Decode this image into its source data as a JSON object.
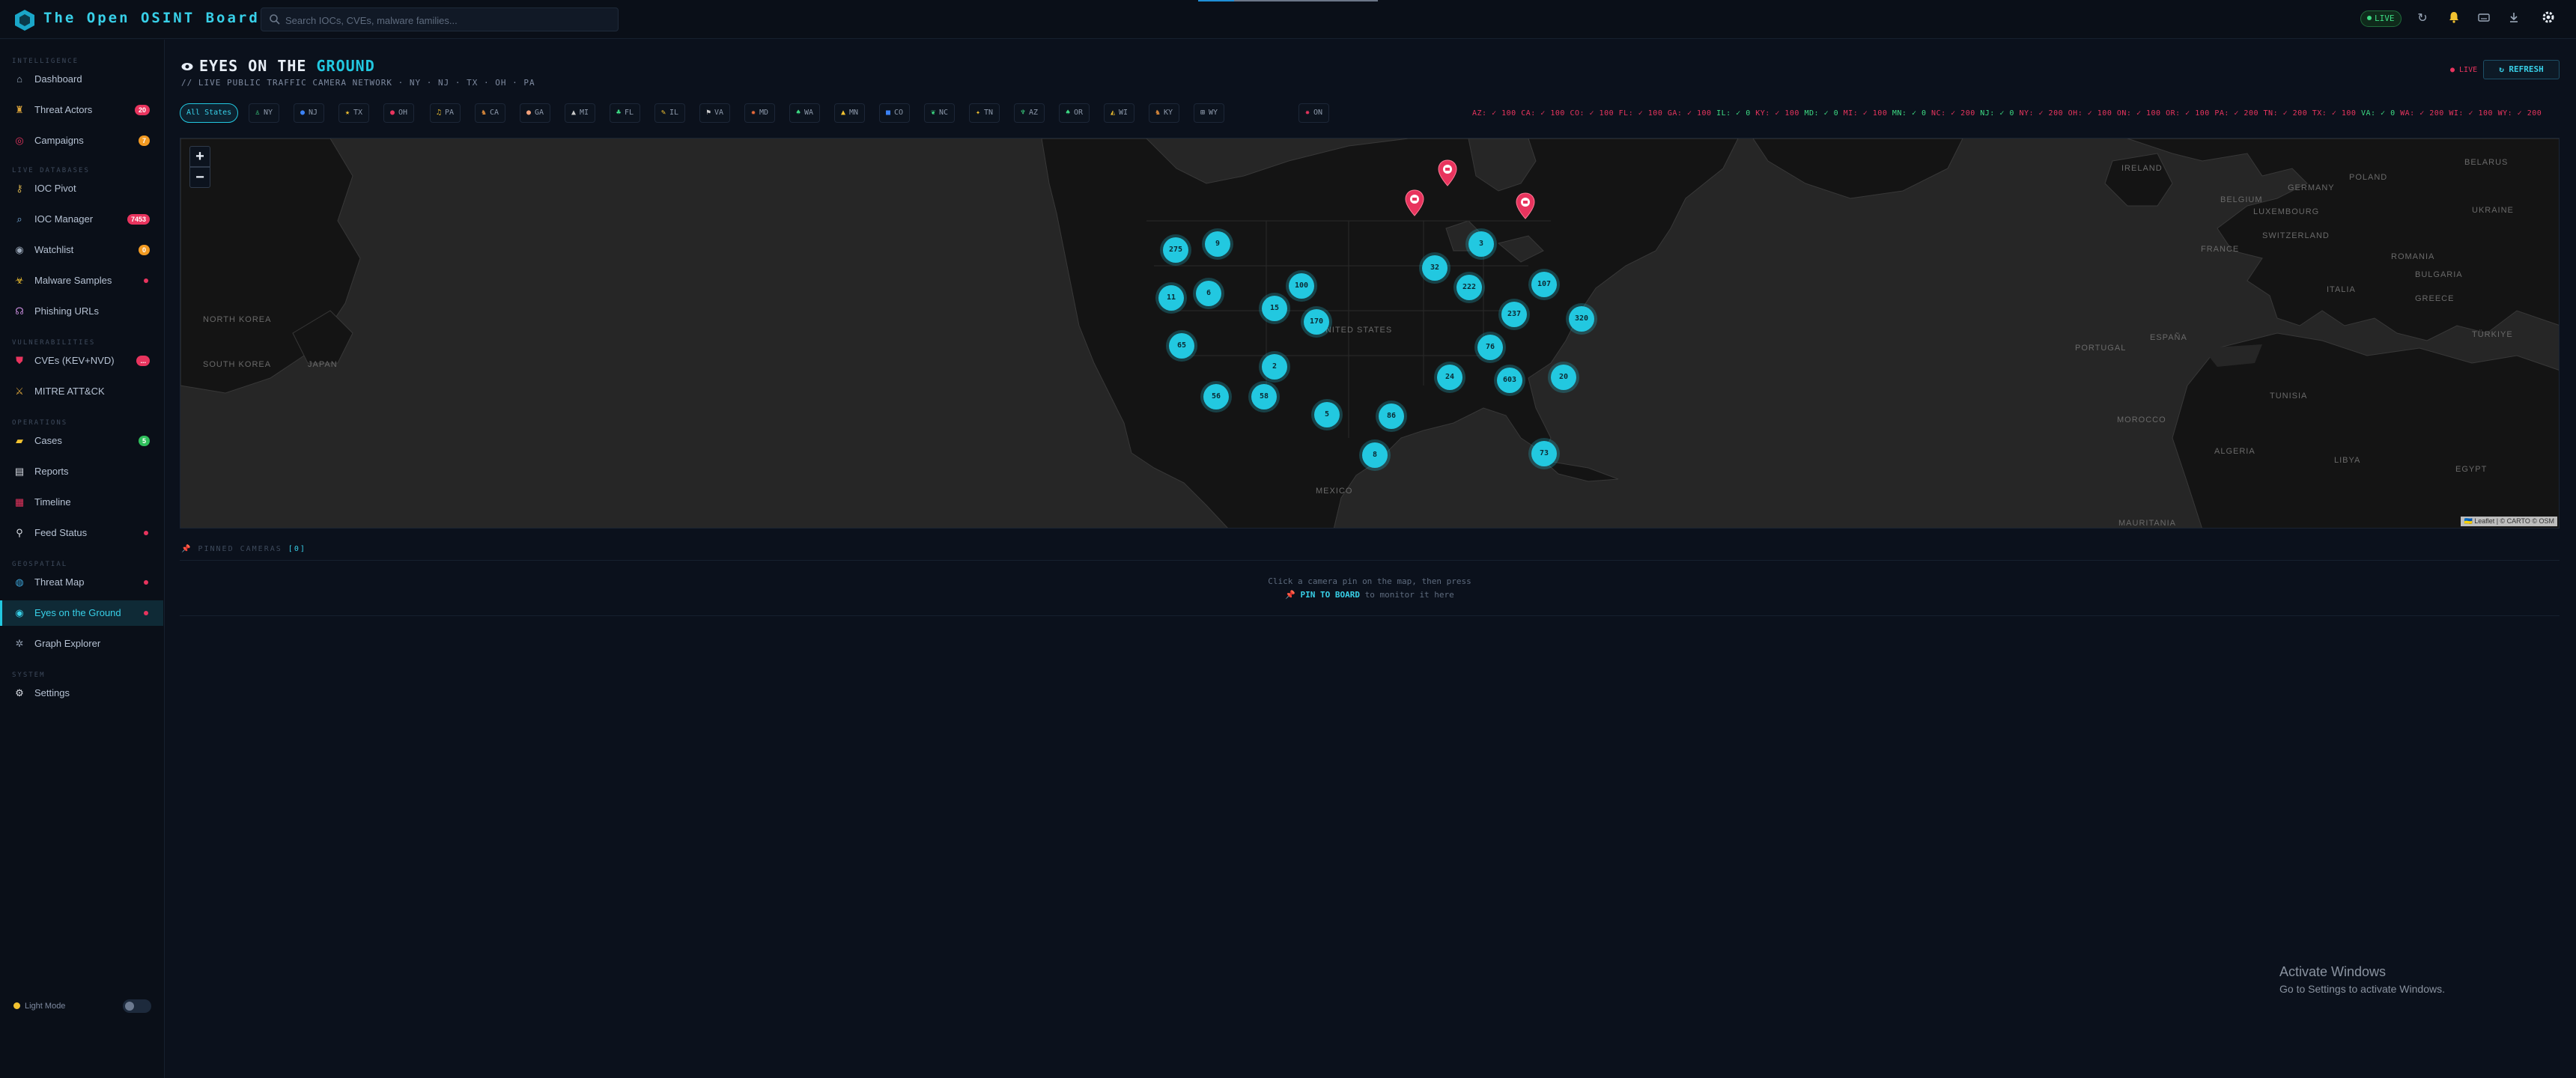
{
  "app": {
    "title": "The Open OSINT Board",
    "live_badge": "LIVE"
  },
  "search": {
    "placeholder": "Search IOCs, CVEs, malware families..."
  },
  "sidebar": {
    "sections": [
      "INTELLIGENCE",
      "LIVE DATABASES",
      "VULNERABILITIES",
      "OPERATIONS",
      "GEOSPATIAL",
      "SYSTEM"
    ],
    "items": [
      {
        "label": "Dashboard",
        "icon": "home-icon"
      },
      {
        "label": "Threat Actors",
        "icon": "user-secret-icon",
        "badge": "20",
        "badge_color": "#e8345e"
      },
      {
        "label": "Campaigns",
        "icon": "target-icon",
        "badge": "7",
        "badge_color": "#f29a22"
      },
      {
        "label": "IOC Pivot",
        "icon": "key-icon"
      },
      {
        "label": "IOC Manager",
        "icon": "search-icon",
        "badge": "7453",
        "badge_color": "#e8345e"
      },
      {
        "label": "Watchlist",
        "icon": "eye-icon",
        "badge": "0",
        "badge_color": "#f29a22"
      },
      {
        "label": "Malware Samples",
        "icon": "biohazard-icon"
      },
      {
        "label": "Phishing URLs",
        "icon": "hook-icon"
      },
      {
        "label": "CVEs (KEV+NVD)",
        "icon": "shield-icon",
        "badge": "...",
        "badge_color": "#e8345e"
      },
      {
        "label": "MITRE ATT&CK",
        "icon": "crossed-swords-icon"
      },
      {
        "label": "Cases",
        "icon": "folder-icon",
        "badge": "5",
        "badge_color": "#2fbf5b"
      },
      {
        "label": "Reports",
        "icon": "document-icon"
      },
      {
        "label": "Timeline",
        "icon": "calendar-icon"
      },
      {
        "label": "Feed Status",
        "icon": "satellite-icon"
      },
      {
        "label": "Threat Map",
        "icon": "globe-icon"
      },
      {
        "label": "Eyes on the Ground",
        "icon": "eye-icon"
      },
      {
        "label": "Graph Explorer",
        "icon": "graph-icon"
      },
      {
        "label": "Settings",
        "icon": "gear-icon"
      }
    ],
    "light_mode": "Light Mode"
  },
  "page": {
    "title_pre": "EYES ON THE",
    "title_accent": "GROUND",
    "subtitle": "// LIVE PUBLIC TRAFFIC CAMERA NETWORK · NY · NJ · TX · OH · PA",
    "live": "● LIVE",
    "refresh": "↻ REFRESH"
  },
  "chips": [
    "All States",
    "NY",
    "NJ",
    "TX",
    "OH",
    "PA",
    "CA",
    "GA",
    "MI",
    "FL",
    "IL",
    "VA",
    "MD",
    "WA",
    "MN",
    "CO",
    "NC",
    "TN",
    "AZ",
    "OR",
    "WI",
    "KY",
    "WY",
    "ON"
  ],
  "status_ticker": [
    {
      "text": "AZ: ✓ 100",
      "ok": false
    },
    {
      "text": "CA: ✓ 100",
      "ok": false
    },
    {
      "text": "CO: ✓ 100",
      "ok": false
    },
    {
      "text": "FL: ✓ 100",
      "ok": false
    },
    {
      "text": "GA: ✓ 100",
      "ok": false
    },
    {
      "text": "IL: ✓ 0",
      "ok": true
    },
    {
      "text": "KY: ✓ 100",
      "ok": false
    },
    {
      "text": "MD: ✓ 0",
      "ok": true
    },
    {
      "text": "MI: ✓ 100",
      "ok": false
    },
    {
      "text": "MN: ✓ 0",
      "ok": true
    },
    {
      "text": "NC: ✓ 200",
      "ok": false
    },
    {
      "text": "NJ: ✓ 0",
      "ok": true
    },
    {
      "text": "NY: ✓ 200",
      "ok": false
    },
    {
      "text": "OH: ✓ 100",
      "ok": false
    },
    {
      "text": "ON: ✓ 100",
      "ok": false
    },
    {
      "text": "OR: ✓ 100",
      "ok": false
    },
    {
      "text": "PA: ✓ 200",
      "ok": false
    },
    {
      "text": "TN: ✓ 200",
      "ok": false
    },
    {
      "text": "TX: ✓ 100",
      "ok": false
    },
    {
      "text": "VA: ✓ 0",
      "ok": true
    },
    {
      "text": "WA: ✓ 200",
      "ok": false
    },
    {
      "text": "WI: ✓ 100",
      "ok": false
    },
    {
      "text": "WY: ✓ 200",
      "ok": false
    }
  ],
  "map": {
    "clusters": [
      "275",
      "9",
      "11",
      "6",
      "100",
      "15",
      "170",
      "65",
      "2",
      "56",
      "58",
      "5",
      "86",
      "8",
      "32",
      "3",
      "222",
      "107",
      "237",
      "320",
      "76",
      "24",
      "603",
      "20",
      "73"
    ],
    "labels": [
      "UNITED STATES",
      "MEXICO",
      "NORTH KOREA",
      "SOUTH KOREA",
      "JAPAN",
      "IRELAND",
      "BELARUS",
      "POLAND",
      "UKRAINE",
      "FRANCE",
      "ROMANIA",
      "BULGARIA",
      "ESPAÑA",
      "PORTUGAL",
      "TÜRKIYE",
      "MOROCCO",
      "ALGERIA",
      "LIBYA",
      "EGYPT",
      "TUNISIA",
      "MAURITANIA",
      "BELGIUM",
      "LUXEMBOURG",
      "GERMANY",
      "SWITZERLAND",
      "ITALIA",
      "GREECE"
    ],
    "attribution": "🇺🇦 Leaflet | © CARTO © OSM",
    "zoom_in": "+",
    "zoom_out": "−"
  },
  "pinned": {
    "label": "📌 PINNED CAMERAS",
    "count": "[0]",
    "empty_line1": "Click a camera pin on the map, then press",
    "empty_cta": "📌 PIN TO BOARD",
    "empty_line2_tail": " to monitor it here"
  },
  "windows": {
    "title": "Activate Windows",
    "subtitle": "Go to Settings to activate Windows."
  }
}
